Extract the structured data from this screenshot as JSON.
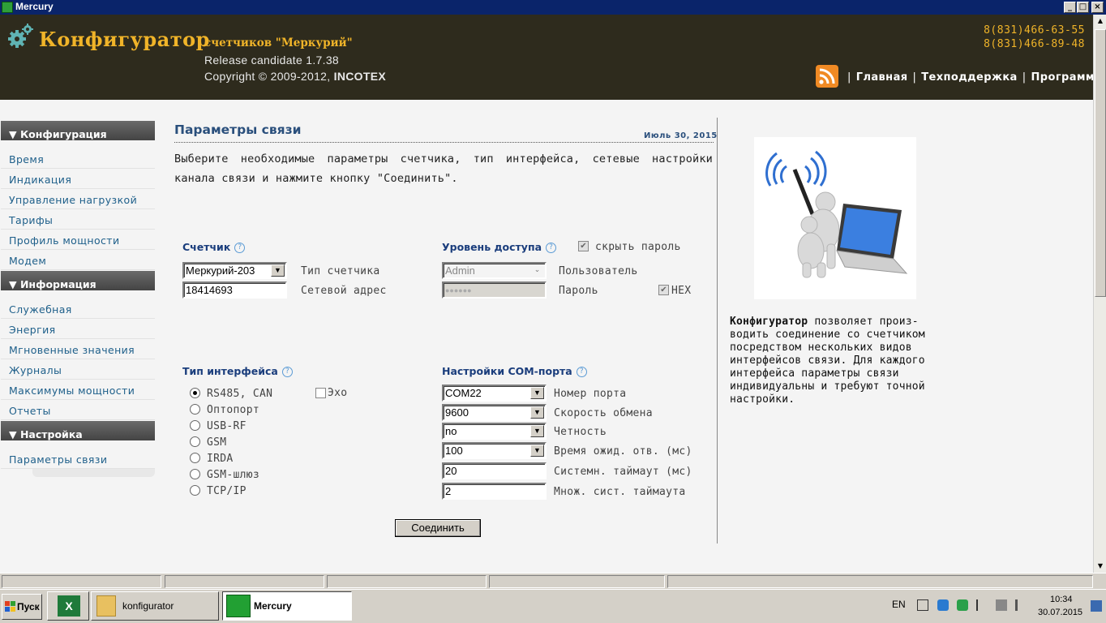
{
  "window": {
    "title": "Mercury",
    "controls": [
      "_",
      "□",
      "×"
    ]
  },
  "header": {
    "brand": "Конфигуратор",
    "subtitle": "счетчиков \"Меркурий\"",
    "release": "Release candidate 1.7.38",
    "copyright_prefix": "Copyright © 2009-2012, ",
    "copyright_company": "INCOTEX",
    "phones": [
      "8(831)466-63-55",
      "8(831)466-89-48"
    ],
    "nav": [
      "Главная",
      "Техподдержка",
      "Программа"
    ],
    "nav_sep": "|"
  },
  "sidebar": {
    "sections": [
      {
        "title": "Конфигурация",
        "items": [
          "Время",
          "Индикация",
          "Управление нагрузкой",
          "Тарифы",
          "Профиль мощности",
          "Модем"
        ]
      },
      {
        "title": "Информация",
        "items": [
          "Служебная",
          "Энергия",
          "Мгновенные значения",
          "Журналы",
          "Максимумы мощности",
          "Отчеты"
        ]
      },
      {
        "title": "Настройка",
        "items": [
          "Параметры связи"
        ]
      }
    ]
  },
  "main": {
    "title": "Параметры связи",
    "date": "Июль 30, 2015",
    "intro": "Выберите необходимые параметры счетчика, тип интерфейса, сетевые настройки канала связи и нажмите кнопку \"Соединить\".",
    "meter": {
      "title": "Счетчик",
      "type_value": "Меркурий-203",
      "type_label": "Тип счетчика",
      "address_value": "18414693",
      "address_label": "Сетевой адрес"
    },
    "access": {
      "title": "Уровень доступа",
      "hide_password_label": "скрыть пароль",
      "hide_password_checked": true,
      "user_value": "Admin",
      "user_label": "Пользователь",
      "password_value": "●●●●●●",
      "password_label": "Пароль",
      "hex_label": "HEX",
      "hex_checked": true
    },
    "interface": {
      "title": "Тип интерфейса",
      "options": [
        "RS485, CAN",
        "Оптопорт",
        "USB-RF",
        "GSM",
        "IRDA",
        "GSM-шлюз",
        "TCP/IP"
      ],
      "selected": "RS485, CAN",
      "echo_label": "Эхо",
      "echo_checked": false
    },
    "com": {
      "title": "Настройки COM-порта",
      "port_value": "COM22",
      "port_label": "Номер порта",
      "baud_value": "9600",
      "baud_label": "Скорость обмена",
      "parity_value": "no",
      "parity_label": "Четность",
      "wait_value": "100",
      "wait_label": "Время ожид. отв. (мс)",
      "timeout_value": "20",
      "timeout_label": "Системн. таймаут (мс)",
      "mult_value": "2",
      "mult_label": "Множ. сист. таймаута"
    },
    "connect_label": "Соединить"
  },
  "aside": {
    "desc_bold": "Конфигуратор",
    "desc_rest": " позволяет произ-водить соединение со счетчиком посредством нескольких видов интерфейсов связи. Для каждого интерфейса параметры связи индивидуальны и требуют точной настройки."
  },
  "taskbar": {
    "start_label": "Пуск",
    "apps": [
      {
        "label": "",
        "icon": "excel-icon"
      },
      {
        "label": "konfigurator",
        "icon": "folder-icon"
      },
      {
        "label": "Mercury",
        "icon": "mercury-icon",
        "active": true
      }
    ],
    "lang": "EN",
    "time": "10:34",
    "date": "30.07.2015"
  }
}
